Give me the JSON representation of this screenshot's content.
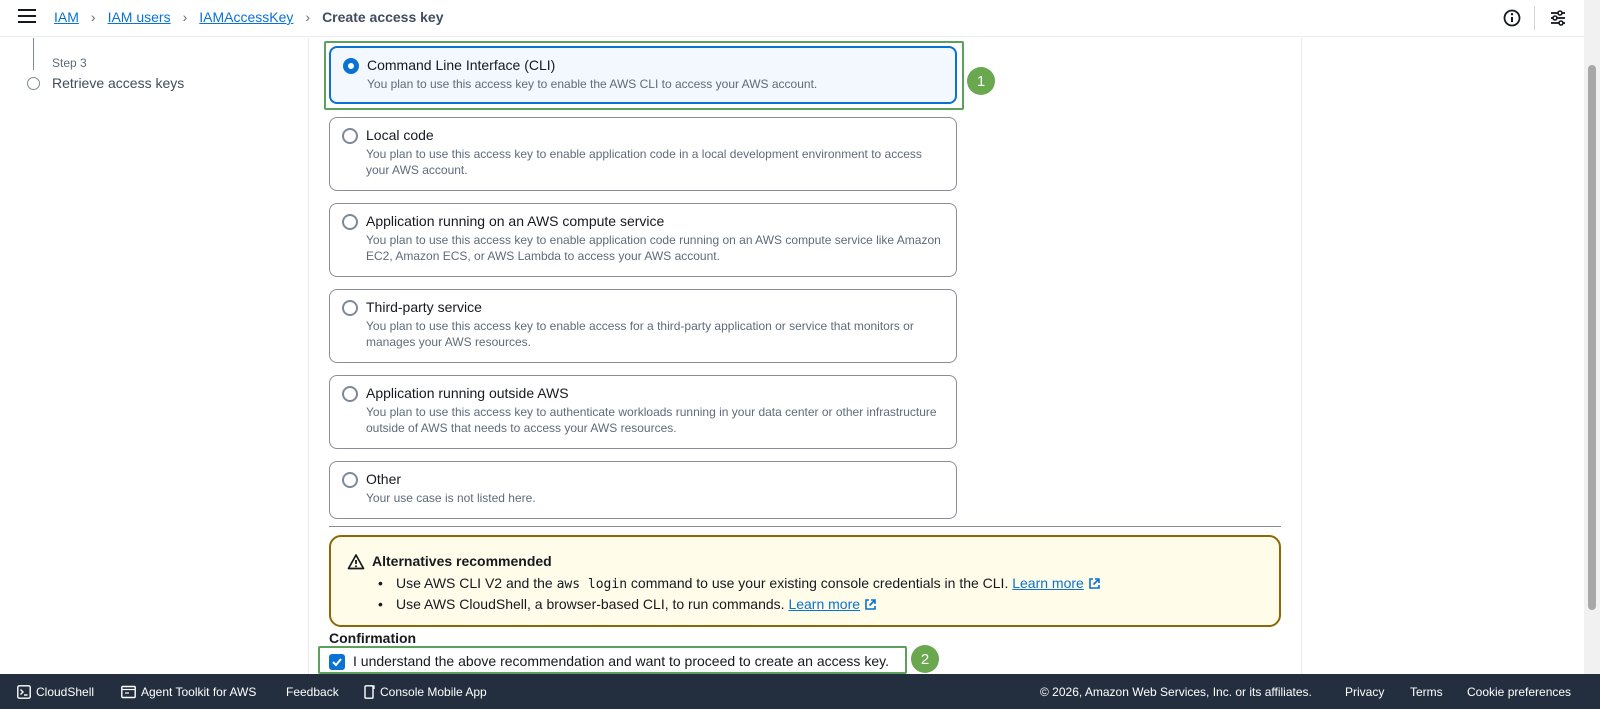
{
  "breadcrumb": {
    "items": [
      "IAM",
      "IAM users",
      "IAMAccessKey"
    ],
    "current": "Create access key"
  },
  "steps": {
    "step3_label": "Step 3",
    "step3_title": "Retrieve access keys"
  },
  "use_cases": [
    {
      "title": "Command Line Interface (CLI)",
      "description": "You plan to use this access key to enable the AWS CLI to access your AWS account.",
      "selected": true
    },
    {
      "title": "Local code",
      "description": "You plan to use this access key to enable application code in a local development environment to access your AWS account.",
      "selected": false
    },
    {
      "title": "Application running on an AWS compute service",
      "description": "You plan to use this access key to enable application code running on an AWS compute service like Amazon EC2, Amazon ECS, or AWS Lambda to access your AWS account.",
      "selected": false
    },
    {
      "title": "Third-party service",
      "description": "You plan to use this access key to enable access for a third-party application or service that monitors or manages your AWS resources.",
      "selected": false
    },
    {
      "title": "Application running outside AWS",
      "description": "You plan to use this access key to authenticate workloads running in your data center or other infrastructure outside of AWS that needs to access your AWS resources.",
      "selected": false
    },
    {
      "title": "Other",
      "description": "Your use case is not listed here.",
      "selected": false
    }
  ],
  "annotations": [
    "1",
    "2"
  ],
  "alert": {
    "title": "Alternatives recommended",
    "item1_prefix": "Use AWS CLI V2 and the",
    "item1_code": "aws login",
    "item1_suffix": "command to use your existing console credentials in the CLI.",
    "item2_text": "Use AWS CloudShell, a browser-based CLI, to run commands.",
    "learn_more": "Learn more"
  },
  "confirmation": {
    "label": "Confirmation",
    "checkbox_text": "I understand the above recommendation and want to proceed to create an access key.",
    "checked": true
  },
  "footer": {
    "cloudshell": "CloudShell",
    "agent_toolkit": "Agent Toolkit for AWS",
    "feedback": "Feedback",
    "mobile_app": "Console Mobile App",
    "copyright": "© 2026, Amazon Web Services, Inc. or its affiliates.",
    "privacy": "Privacy",
    "terms": "Terms",
    "cookies": "Cookie preferences"
  },
  "colors": {
    "link": "#0972d3",
    "annotation_green": "#6aa84f",
    "warning_border": "#8d6605",
    "footer_bg": "#232f3e"
  }
}
